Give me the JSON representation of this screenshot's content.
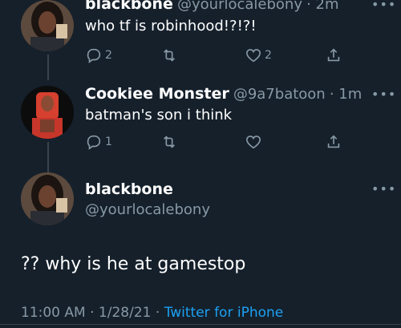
{
  "tweet1": {
    "name": "blackbone",
    "handle": "@yourlocalebony",
    "time": "· 2m",
    "text": "who tf is robinhood!?!?!",
    "replies": "2",
    "likes": "2"
  },
  "tweet2": {
    "name": "Cookiee Monster",
    "handle": "@9a7batoon",
    "time": "· 1m",
    "text": "batman's son i think",
    "replies": "1"
  },
  "tweet3": {
    "name": "blackbone",
    "handle": "@yourlocalebony",
    "text": "?? why is he at gamestop",
    "time": "11:00 AM",
    "sep1": "·",
    "date": "1/28/21",
    "sep2": "·",
    "source": "Twitter for iPhone"
  },
  "more_label": "•••",
  "icons": [
    "reply-icon",
    "retweet-icon",
    "like-icon",
    "share-icon",
    "more-icon"
  ],
  "colors": {
    "background": "#15202b",
    "muted": "#8899a6",
    "link": "#1da1f2",
    "line": "#38444d"
  }
}
